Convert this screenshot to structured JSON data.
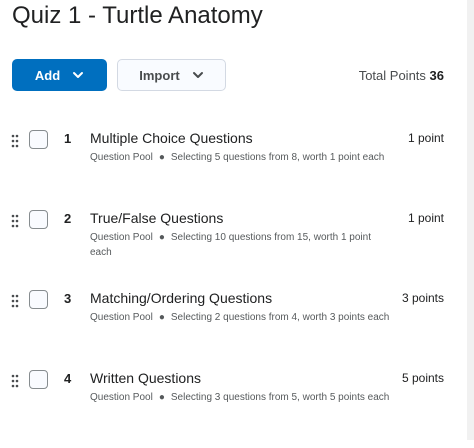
{
  "page": {
    "title": "Quiz 1 - Turtle Anatomy"
  },
  "toolbar": {
    "add_label": "Add",
    "import_label": "Import",
    "total_points_label": "Total Points",
    "total_points_value": "36"
  },
  "questions": [
    {
      "number": "1",
      "title": "Multiple Choice Questions",
      "type": "Question Pool",
      "detail": "Selecting 5 questions from 8, worth 1 point each",
      "points": "1 point"
    },
    {
      "number": "2",
      "title": "True/False Questions",
      "type": "Question Pool",
      "detail": "Selecting 10 questions from 15, worth 1 point each",
      "points": "1 point"
    },
    {
      "number": "3",
      "title": "Matching/Ordering Questions",
      "type": "Question Pool",
      "detail": "Selecting 2 questions from 4, worth 3 points each",
      "points": "3 points"
    },
    {
      "number": "4",
      "title": "Written Questions",
      "type": "Question Pool",
      "detail": "Selecting 3 questions from 5, worth 5 points each",
      "points": "5 points"
    }
  ],
  "colors": {
    "primary_button": "#006fbf",
    "text_dark": "#202122",
    "text_muted": "#565a5c"
  }
}
